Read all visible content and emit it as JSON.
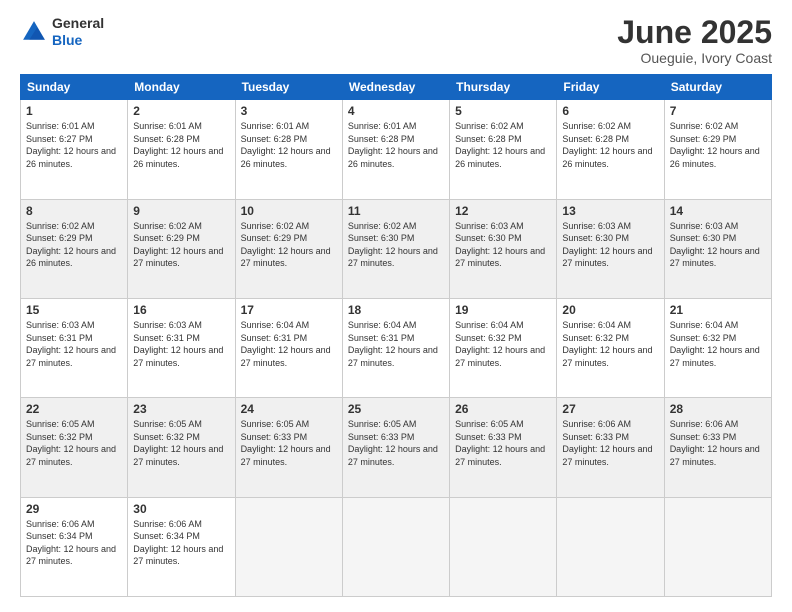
{
  "header": {
    "logo_line1": "General",
    "logo_line2": "Blue",
    "month_title": "June 2025",
    "location": "Oueguie, Ivory Coast"
  },
  "weekdays": [
    "Sunday",
    "Monday",
    "Tuesday",
    "Wednesday",
    "Thursday",
    "Friday",
    "Saturday"
  ],
  "rows": [
    [
      {
        "day": "1",
        "sunrise": "6:01 AM",
        "sunset": "6:27 PM",
        "daylight": "12 hours and 26 minutes."
      },
      {
        "day": "2",
        "sunrise": "6:01 AM",
        "sunset": "6:28 PM",
        "daylight": "12 hours and 26 minutes."
      },
      {
        "day": "3",
        "sunrise": "6:01 AM",
        "sunset": "6:28 PM",
        "daylight": "12 hours and 26 minutes."
      },
      {
        "day": "4",
        "sunrise": "6:01 AM",
        "sunset": "6:28 PM",
        "daylight": "12 hours and 26 minutes."
      },
      {
        "day": "5",
        "sunrise": "6:02 AM",
        "sunset": "6:28 PM",
        "daylight": "12 hours and 26 minutes."
      },
      {
        "day": "6",
        "sunrise": "6:02 AM",
        "sunset": "6:28 PM",
        "daylight": "12 hours and 26 minutes."
      },
      {
        "day": "7",
        "sunrise": "6:02 AM",
        "sunset": "6:29 PM",
        "daylight": "12 hours and 26 minutes."
      }
    ],
    [
      {
        "day": "8",
        "sunrise": "6:02 AM",
        "sunset": "6:29 PM",
        "daylight": "12 hours and 26 minutes."
      },
      {
        "day": "9",
        "sunrise": "6:02 AM",
        "sunset": "6:29 PM",
        "daylight": "12 hours and 27 minutes."
      },
      {
        "day": "10",
        "sunrise": "6:02 AM",
        "sunset": "6:29 PM",
        "daylight": "12 hours and 27 minutes."
      },
      {
        "day": "11",
        "sunrise": "6:02 AM",
        "sunset": "6:30 PM",
        "daylight": "12 hours and 27 minutes."
      },
      {
        "day": "12",
        "sunrise": "6:03 AM",
        "sunset": "6:30 PM",
        "daylight": "12 hours and 27 minutes."
      },
      {
        "day": "13",
        "sunrise": "6:03 AM",
        "sunset": "6:30 PM",
        "daylight": "12 hours and 27 minutes."
      },
      {
        "day": "14",
        "sunrise": "6:03 AM",
        "sunset": "6:30 PM",
        "daylight": "12 hours and 27 minutes."
      }
    ],
    [
      {
        "day": "15",
        "sunrise": "6:03 AM",
        "sunset": "6:31 PM",
        "daylight": "12 hours and 27 minutes."
      },
      {
        "day": "16",
        "sunrise": "6:03 AM",
        "sunset": "6:31 PM",
        "daylight": "12 hours and 27 minutes."
      },
      {
        "day": "17",
        "sunrise": "6:04 AM",
        "sunset": "6:31 PM",
        "daylight": "12 hours and 27 minutes."
      },
      {
        "day": "18",
        "sunrise": "6:04 AM",
        "sunset": "6:31 PM",
        "daylight": "12 hours and 27 minutes."
      },
      {
        "day": "19",
        "sunrise": "6:04 AM",
        "sunset": "6:32 PM",
        "daylight": "12 hours and 27 minutes."
      },
      {
        "day": "20",
        "sunrise": "6:04 AM",
        "sunset": "6:32 PM",
        "daylight": "12 hours and 27 minutes."
      },
      {
        "day": "21",
        "sunrise": "6:04 AM",
        "sunset": "6:32 PM",
        "daylight": "12 hours and 27 minutes."
      }
    ],
    [
      {
        "day": "22",
        "sunrise": "6:05 AM",
        "sunset": "6:32 PM",
        "daylight": "12 hours and 27 minutes."
      },
      {
        "day": "23",
        "sunrise": "6:05 AM",
        "sunset": "6:32 PM",
        "daylight": "12 hours and 27 minutes."
      },
      {
        "day": "24",
        "sunrise": "6:05 AM",
        "sunset": "6:33 PM",
        "daylight": "12 hours and 27 minutes."
      },
      {
        "day": "25",
        "sunrise": "6:05 AM",
        "sunset": "6:33 PM",
        "daylight": "12 hours and 27 minutes."
      },
      {
        "day": "26",
        "sunrise": "6:05 AM",
        "sunset": "6:33 PM",
        "daylight": "12 hours and 27 minutes."
      },
      {
        "day": "27",
        "sunrise": "6:06 AM",
        "sunset": "6:33 PM",
        "daylight": "12 hours and 27 minutes."
      },
      {
        "day": "28",
        "sunrise": "6:06 AM",
        "sunset": "6:33 PM",
        "daylight": "12 hours and 27 minutes."
      }
    ],
    [
      {
        "day": "29",
        "sunrise": "6:06 AM",
        "sunset": "6:34 PM",
        "daylight": "12 hours and 27 minutes."
      },
      {
        "day": "30",
        "sunrise": "6:06 AM",
        "sunset": "6:34 PM",
        "daylight": "12 hours and 27 minutes."
      },
      null,
      null,
      null,
      null,
      null
    ]
  ]
}
